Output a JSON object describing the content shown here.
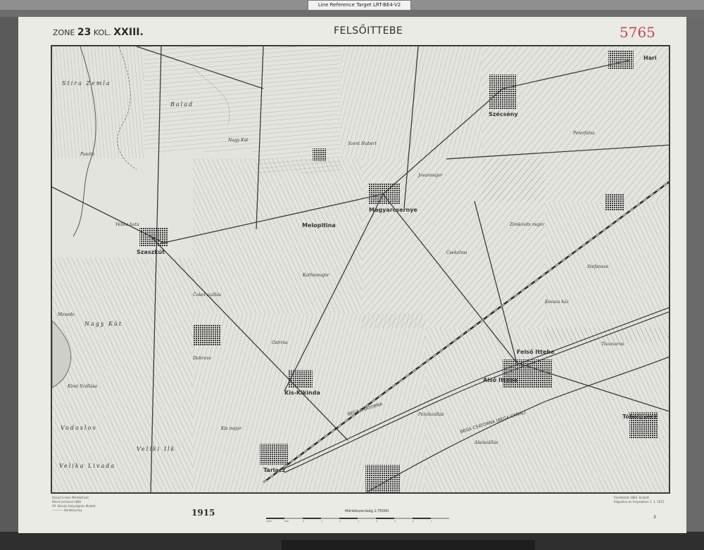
{
  "scan": {
    "reference_target": "Line Reference Target LRT-BE4-V2"
  },
  "sheet": {
    "zone_word": "ZONE",
    "zone_number": "23",
    "kol_word": "KOL.",
    "kol_number": "XXIII.",
    "title": "FELSŐITTEBE",
    "handwritten_number": "5765",
    "year": "1915",
    "page_index": "3"
  },
  "scale": {
    "label": "Mértékszerűség 1:75000",
    "ticks": [
      "1000",
      "500",
      "0",
      "1",
      "2",
      "3",
      "4",
      "5",
      "6",
      "7"
    ]
  },
  "legend_lines": [
    "Ősszel Ív-ben Mértékfüzet",
    "Rövid Leírással 1884",
    "(Pl. Károly) Helységnév Mutató",
    "———— Kerékösvény"
  ],
  "survey_note": [
    "Felvétetett 1884. Kiadott",
    "Kiigazítva és helyesbítve 1. 3. 1915"
  ],
  "places": {
    "towns": [
      "Szaszkút",
      "Melopitina",
      "Szécsény",
      "Hari",
      "Felső Ittebe",
      "Alsó Ittebe",
      "Tóbolovecz",
      "Tarlacz",
      "Kis-Kikinda",
      "Magyarcsernye"
    ],
    "areas": [
      "Stira Zemla",
      "Balad",
      "Nagy Kút",
      "Velika Livada",
      "Vodoslov",
      "Veliki Ilk",
      "Kinsi Szállása",
      "Mesedo",
      "Ostrina",
      "Čoket szállás",
      "Kathiamajor",
      "Stefanovo"
    ],
    "fields": [
      "Puszta",
      "Nagy Kút",
      "Szent Hubert",
      "Jovanmajor",
      "Csekelma",
      "Zimkovits major",
      "Peterfalva",
      "Tiszavaros",
      "Felsőszállás",
      "Alsószállás",
      "Kis major",
      "Dubrava",
      "Kovacs ház",
      "Velika kuta"
    ]
  },
  "canals": [
    "BEGA CSATORNA",
    "BEGA CSATORNA (BEGA CANAL)"
  ]
}
